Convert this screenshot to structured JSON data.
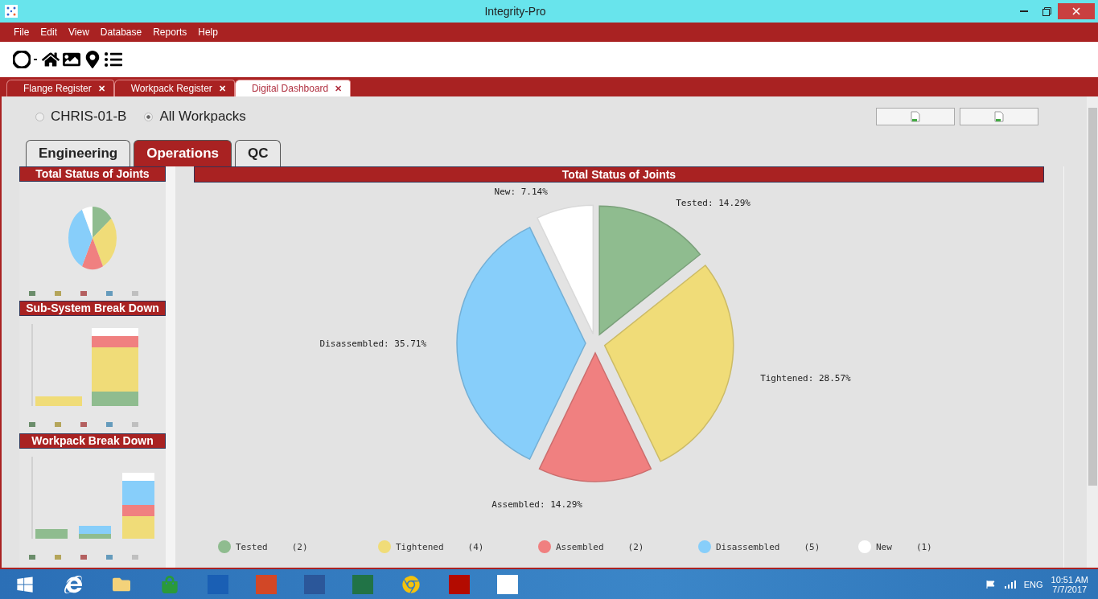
{
  "window": {
    "title": "Integrity-Pro"
  },
  "menu": [
    "File",
    "Edit",
    "View",
    "Database",
    "Reports",
    "Help"
  ],
  "doc_tabs": [
    {
      "label": "Flange Register",
      "close": "✕",
      "selected": false
    },
    {
      "label": "Workpack Register",
      "close": "✕",
      "selected": false
    },
    {
      "label": "Digital Dashboard",
      "close": "✕",
      "selected": true
    }
  ],
  "scope": [
    {
      "label": "CHRIS-01-B",
      "selected": false
    },
    {
      "label": "All Workpacks",
      "selected": true
    }
  ],
  "tabs": [
    {
      "label": "Engineering",
      "selected": false
    },
    {
      "label": "Operations",
      "selected": true
    },
    {
      "label": "QC",
      "selected": false
    }
  ],
  "sidebar": {
    "panels": [
      {
        "title": "Total Status of Joints",
        "kind": "pie"
      },
      {
        "title": "Sub-System Break Down",
        "kind": "bars"
      },
      {
        "title": "Workpack Break Down",
        "kind": "bars"
      }
    ]
  },
  "main": {
    "title": "Total Status of Joints",
    "chart_data": {
      "type": "pie",
      "categories": [
        "Tested",
        "Tightened",
        "Assembled",
        "Disassembled",
        "New"
      ],
      "series": [
        {
          "values": [
            14.29,
            28.57,
            14.29,
            35.71,
            7.14
          ],
          "colors": [
            "#8fbc8f",
            "#f0dc78",
            "#f08080",
            "#87cefa",
            "#ffffff"
          ]
        }
      ],
      "value_labels": [
        "Tested: 14.29%",
        "Tightened: 28.57%",
        "Assembled: 14.29%",
        "Disassembled: 35.71%",
        "New: 7.14%"
      ]
    },
    "legend_counts": [
      "(2)",
      "(4)",
      "(2)",
      "(5)",
      "(1)"
    ]
  },
  "tray": {
    "language": "ENG",
    "time": "10:51 AM",
    "date": "7/7/2017"
  }
}
